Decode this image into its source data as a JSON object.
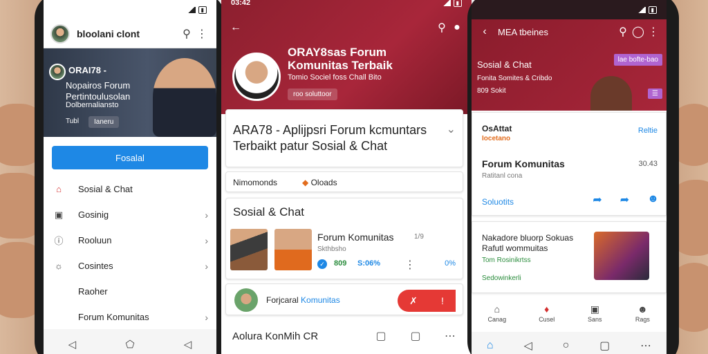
{
  "phone_left": {
    "status": {
      "time": "",
      "battery": ""
    },
    "appbar": {
      "title": "bloolani clont"
    },
    "hero": {
      "title": "ORAI78 -",
      "line1": "Nopairos Forum",
      "line2": "Pertintoulusolan",
      "line3": "Dolbernaliansto",
      "tag": "Tubl",
      "tag_button": "Ianeru"
    },
    "primary_button": "Fosalal",
    "menu": [
      {
        "label": "Sosial & Chat",
        "icon": "home-icon",
        "chevron": false
      },
      {
        "label": "Gosinig",
        "icon": "document-icon",
        "chevron": true
      },
      {
        "label": "Rooluun",
        "icon": "info-icon",
        "chevron": true
      },
      {
        "label": "Cosintes",
        "icon": "chat-icon",
        "chevron": true
      },
      {
        "label": "Raoher",
        "icon": "",
        "chevron": false
      },
      {
        "label": "Forum Komunitas",
        "icon": "",
        "chevron": true
      }
    ]
  },
  "phone_mid": {
    "status": {
      "time": "03:42",
      "battery": ""
    },
    "header": {
      "title": "ORAY8sas Forum Komunitas Terbaik",
      "subtitle": "Tomio Sociel foss Chall Bito",
      "badge": "roo soluttoor"
    },
    "card_title": "ARA78 - Aplijpsri Forum kcmuntars Terbaikt patur Sosial & Chat",
    "meta": {
      "left": "Nimomonds",
      "right": "Oloads"
    },
    "section": {
      "title": "Sosial & Chat",
      "item_title": "Forum Komunitas",
      "item_value": "1/9",
      "item_sub": "Skthbsho",
      "stat1": "809",
      "stat2": "S:06%",
      "stat3": "0%"
    },
    "promo": {
      "prefix": "Forjcaral ",
      "highlight": "Komunitas"
    },
    "bottom_title": "Aolura KonMih CR"
  },
  "phone_right": {
    "status": {
      "time": "",
      "battery": ""
    },
    "topbar": {
      "title": "MEA tbeines"
    },
    "head": {
      "title": "Sosial & Chat",
      "subtitle": "Fonita Somites & Cribdo",
      "count": "809 Sokit",
      "pill": "lae bofte-bao"
    },
    "card": {
      "brand1": "OsAttat",
      "brand2": "Iocetano",
      "link": "Reltie",
      "title": "Forum Komunitas",
      "value": "30.43",
      "sub": "Ratitanl cona",
      "solution": "Soluotits"
    },
    "card2": {
      "title": "Nakadore bluorp Sokuas Rafutl wommuitas",
      "green1": "Tom Rosinikrtss",
      "green2": "Sedowinkerli"
    },
    "tabs": [
      {
        "label": "Canag",
        "icon": "home-icon"
      },
      {
        "label": "Cusel",
        "icon": "chat-icon"
      },
      {
        "label": "Sans",
        "icon": "grid-icon"
      },
      {
        "label": "Rags",
        "icon": "user-icon"
      }
    ]
  },
  "colors": {
    "accent": "#1e88e5",
    "brand": "#a8263a",
    "danger": "#e53935",
    "positive": "#2a8c3c"
  }
}
